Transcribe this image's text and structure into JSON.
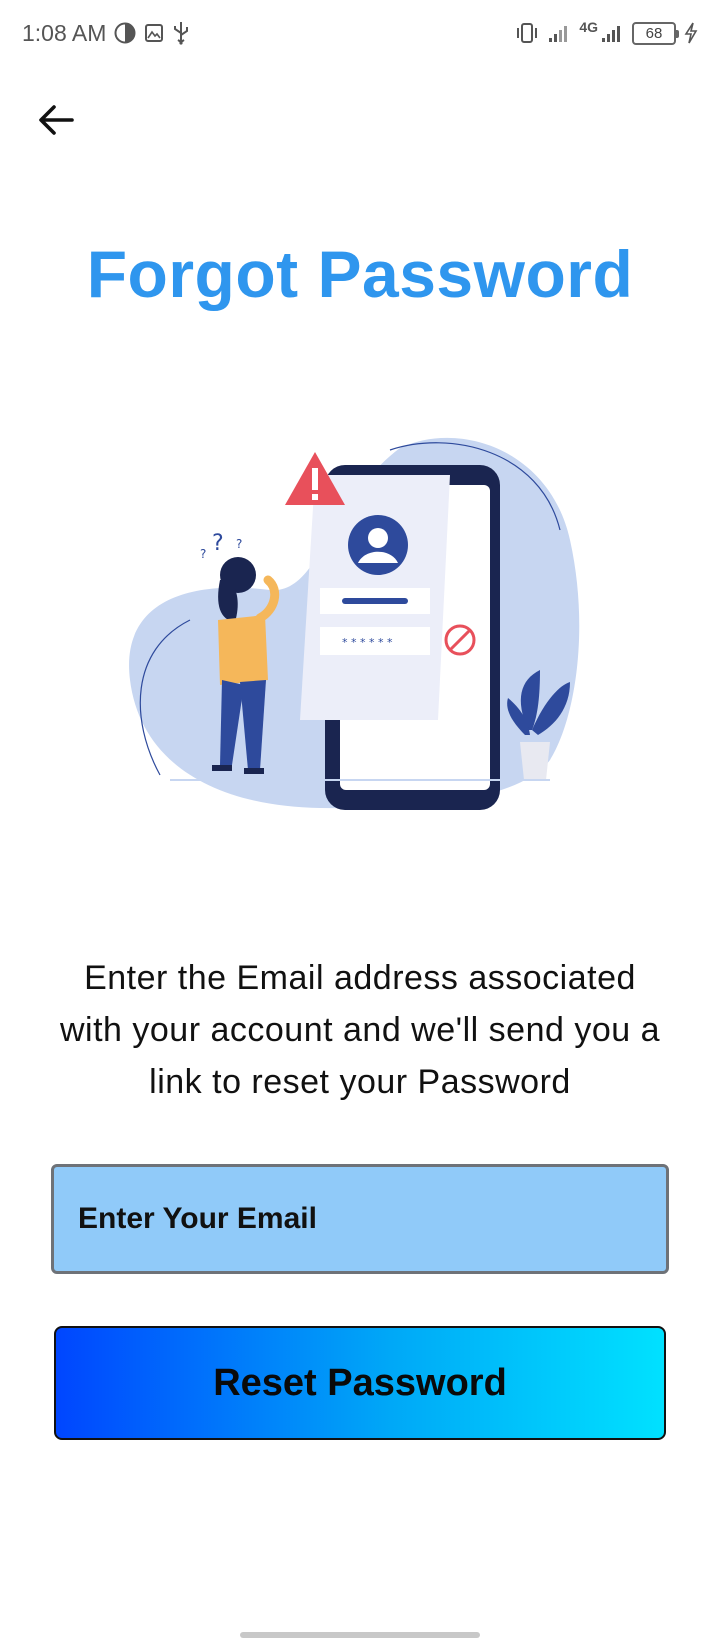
{
  "status_bar": {
    "time": "1:08 AM",
    "network": "4G",
    "battery": "68",
    "icons": [
      "notification-icon",
      "gallery-icon",
      "usb-icon",
      "vibrate-icon",
      "signal-icon",
      "charging-icon"
    ]
  },
  "header": {
    "back_icon": "arrow-left-icon"
  },
  "title": "Forgot Password",
  "illustration": {
    "icon": "forgot-password-illustration"
  },
  "description": "Enter the Email address associated with your account and we'll send you a link to reset your Password",
  "email_field": {
    "placeholder": "Enter Your Email",
    "value": ""
  },
  "reset_button": {
    "label": "Reset Password"
  },
  "colors": {
    "title": "#2f96ee",
    "field_bg": "#90caf9",
    "button_gradient_start": "#0046ff",
    "button_gradient_end": "#00e1ff"
  }
}
